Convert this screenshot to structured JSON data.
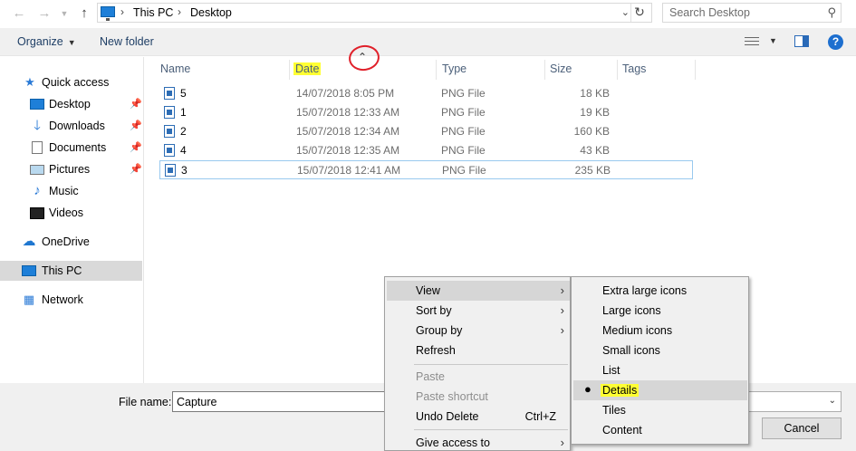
{
  "address_bar": {
    "crumbs": [
      "This PC",
      "Desktop"
    ],
    "search_placeholder": "Search Desktop"
  },
  "toolbar": {
    "organize": "Organize",
    "new_folder": "New folder"
  },
  "nav_pane": {
    "items": [
      {
        "label": "Quick access",
        "icon": "star-icon",
        "pinned": false
      },
      {
        "label": "Desktop",
        "icon": "desktop-icon",
        "pinned": true
      },
      {
        "label": "Downloads",
        "icon": "download-arrow-icon",
        "pinned": true
      },
      {
        "label": "Documents",
        "icon": "document-icon",
        "pinned": true
      },
      {
        "label": "Pictures",
        "icon": "pictures-icon",
        "pinned": true
      },
      {
        "label": "Music",
        "icon": "music-note-icon",
        "pinned": false
      },
      {
        "label": "Videos",
        "icon": "film-icon",
        "pinned": false
      },
      {
        "label": "OneDrive",
        "icon": "cloud-icon",
        "pinned": false
      },
      {
        "label": "This PC",
        "icon": "computer-icon",
        "pinned": false
      },
      {
        "label": "Network",
        "icon": "network-icon",
        "pinned": false
      }
    ]
  },
  "columns": {
    "name": "Name",
    "date": "Date",
    "type": "Type",
    "size": "Size",
    "tags": "Tags"
  },
  "files": [
    {
      "name": "5",
      "date": "14/07/2018 8:05 PM",
      "type": "PNG File",
      "size": "18 KB"
    },
    {
      "name": "1",
      "date": "15/07/2018 12:33 AM",
      "type": "PNG File",
      "size": "19 KB"
    },
    {
      "name": "2",
      "date": "15/07/2018 12:34 AM",
      "type": "PNG File",
      "size": "160 KB"
    },
    {
      "name": "4",
      "date": "15/07/2018 12:35 AM",
      "type": "PNG File",
      "size": "43 KB"
    },
    {
      "name": "3",
      "date": "15/07/2018 12:41 AM",
      "type": "PNG File",
      "size": "235 KB"
    }
  ],
  "bottom": {
    "file_name_label": "File name:",
    "file_name_value": "Capture",
    "cancel": "Cancel"
  },
  "context_menu": {
    "view": "View",
    "sort_by": "Sort by",
    "group_by": "Group by",
    "refresh": "Refresh",
    "paste": "Paste",
    "paste_shortcut": "Paste shortcut",
    "undo_delete": "Undo Delete",
    "undo_shortcut": "Ctrl+Z",
    "give_access": "Give access to"
  },
  "view_submenu": {
    "extra_large": "Extra large icons",
    "large": "Large icons",
    "medium": "Medium icons",
    "small": "Small icons",
    "list": "List",
    "details": "Details",
    "tiles": "Tiles",
    "content": "Content"
  },
  "colors": {
    "highlight": "#ffff33",
    "annotation_circle": "#e0202a",
    "selection_border": "#99c9ef"
  }
}
